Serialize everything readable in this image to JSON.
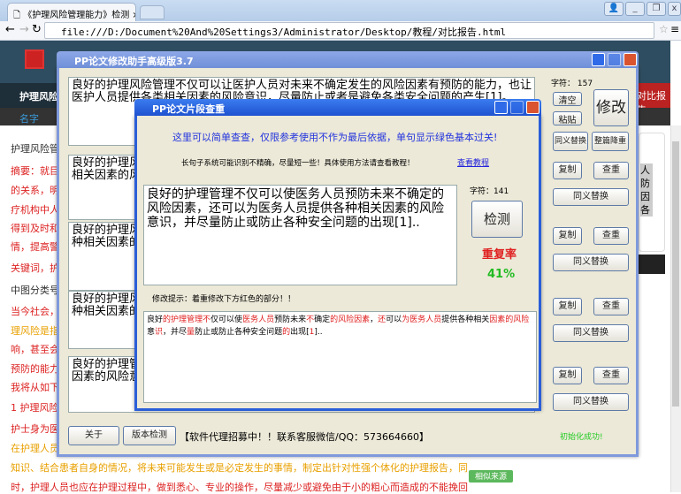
{
  "browser": {
    "tab_title": "《护理风险管理能力》检测",
    "url": "file:///D:/Document%20And%20Settings3/Administrator/Desktop/教程/对比报告.html"
  },
  "page": {
    "nav_item": "护理风险",
    "nav_right": "对比报告",
    "subnav_item": "名字",
    "similar_source": "相似来源",
    "lines": [
      {
        "t": "护理风险管",
        "c": ""
      },
      {
        "t": "摘要：就目",
        "c": "red"
      },
      {
        "t": "的关系，明",
        "c": "red"
      },
      {
        "t": "疗机构中人",
        "c": "red"
      },
      {
        "t": "得到及时和",
        "c": "red"
      },
      {
        "t": "情，提高警",
        "c": "red"
      },
      {
        "t": "关键词，护",
        "c": "red"
      },
      {
        "t": "中图分类号",
        "c": ""
      },
      {
        "t": "当今社会，",
        "c": "red"
      },
      {
        "t": "理风险是指",
        "c": "org"
      },
      {
        "t": "响，甚至会",
        "c": "red"
      },
      {
        "t": "预防的能力",
        "c": "red"
      },
      {
        "t": "我将从如下",
        "c": "red"
      },
      {
        "t": "1 护理风险",
        "c": "red"
      },
      {
        "t": "护士身为医",
        "c": "red"
      },
      {
        "t": "在护理人员",
        "c": "org"
      }
    ],
    "bottom_line1": "知识、结合患者自身的情况，将未来可能发生或是必定发生的事情，制定出针对性强个体化的护理报告，同",
    "bottom_line2": "时，护理人员也应在护理过程中，做到悉心、专业的操作，尽量减少或避免由于小的粗心而造成的不能挽回",
    "side_chars": "人\n防\n因\n各"
  },
  "outer": {
    "title": "PP论文修改助手高级版3.7",
    "char_count": "字符： 157",
    "box1": "良好的护理风险管理不仅可以让医护人员对未来不确定发生的风险因素有预防的能力，也让医护人员提供各类相关因素的风险意识，尽量防止或者是避免各类安全问题的产生[1]。",
    "box2": "良好的护理风\n相关因素的风",
    "box3": "良好的护理风\n种相关因素的",
    "box4": "良好的护理风\n种相关因素的",
    "box5": "良好的护理管\n因素的风险意",
    "clear": "清空",
    "paste": "粘贴",
    "modify": "修改",
    "synonym": "同义替换",
    "whole_reduce": "整篇降重",
    "copy": "复制",
    "check": "查重",
    "about": "关于",
    "version_check": "版本检测",
    "ad": "【软件代理招募中！！联系客服微信/QQ：573664660】",
    "init_ok": "初始化成功!"
  },
  "inner": {
    "title": "PP论文片段查重",
    "notice": "这里可以简单查查，仅限参考使用不作为最后依据，单句显示绿色基本过关!",
    "tip": "长句子系统可能识别不精确，尽量短一些！具体使用方法请查看教程！",
    "tutorial_link": "查看教程",
    "input_text": "良好的护理管理不仅可以使医务人员预防未来不确定的风险因素，还可以为医务人员提供各种相关因素的风险意识，并尽量防止或防止各种安全问题的出现[1]..",
    "char_count": "字符：141",
    "detect": "检测",
    "rate_label": "重复率",
    "rate_value": "41%",
    "hint": "修改提示：着重修改下方红色的部分！！",
    "result_segments": [
      [
        "良好",
        0
      ],
      [
        "的护理管理",
        1
      ],
      [
        "不",
        1
      ],
      [
        "仅可以使",
        0
      ],
      [
        "医务人员",
        1
      ],
      [
        "预防未来",
        0
      ],
      [
        "不",
        1
      ],
      [
        "确定",
        0
      ],
      [
        "的风险因素",
        1
      ],
      [
        "，",
        0
      ],
      [
        "还",
        1
      ],
      [
        "可以",
        0
      ],
      [
        "为医务人员",
        1
      ],
      [
        "提供各种相关",
        0
      ],
      [
        "因素的风险",
        1
      ],
      [
        "意",
        0
      ],
      [
        "识",
        1
      ],
      [
        "，并尽",
        0
      ],
      [
        "量",
        1
      ],
      [
        "防止或防止各种安全问题",
        0
      ],
      [
        "的",
        1
      ],
      [
        "出现[",
        0
      ],
      [
        "1",
        1
      ],
      [
        "]..",
        0
      ]
    ]
  },
  "colors": {
    "accent": "#2a5ed8",
    "red": "#e02020",
    "green": "#22bb22"
  }
}
